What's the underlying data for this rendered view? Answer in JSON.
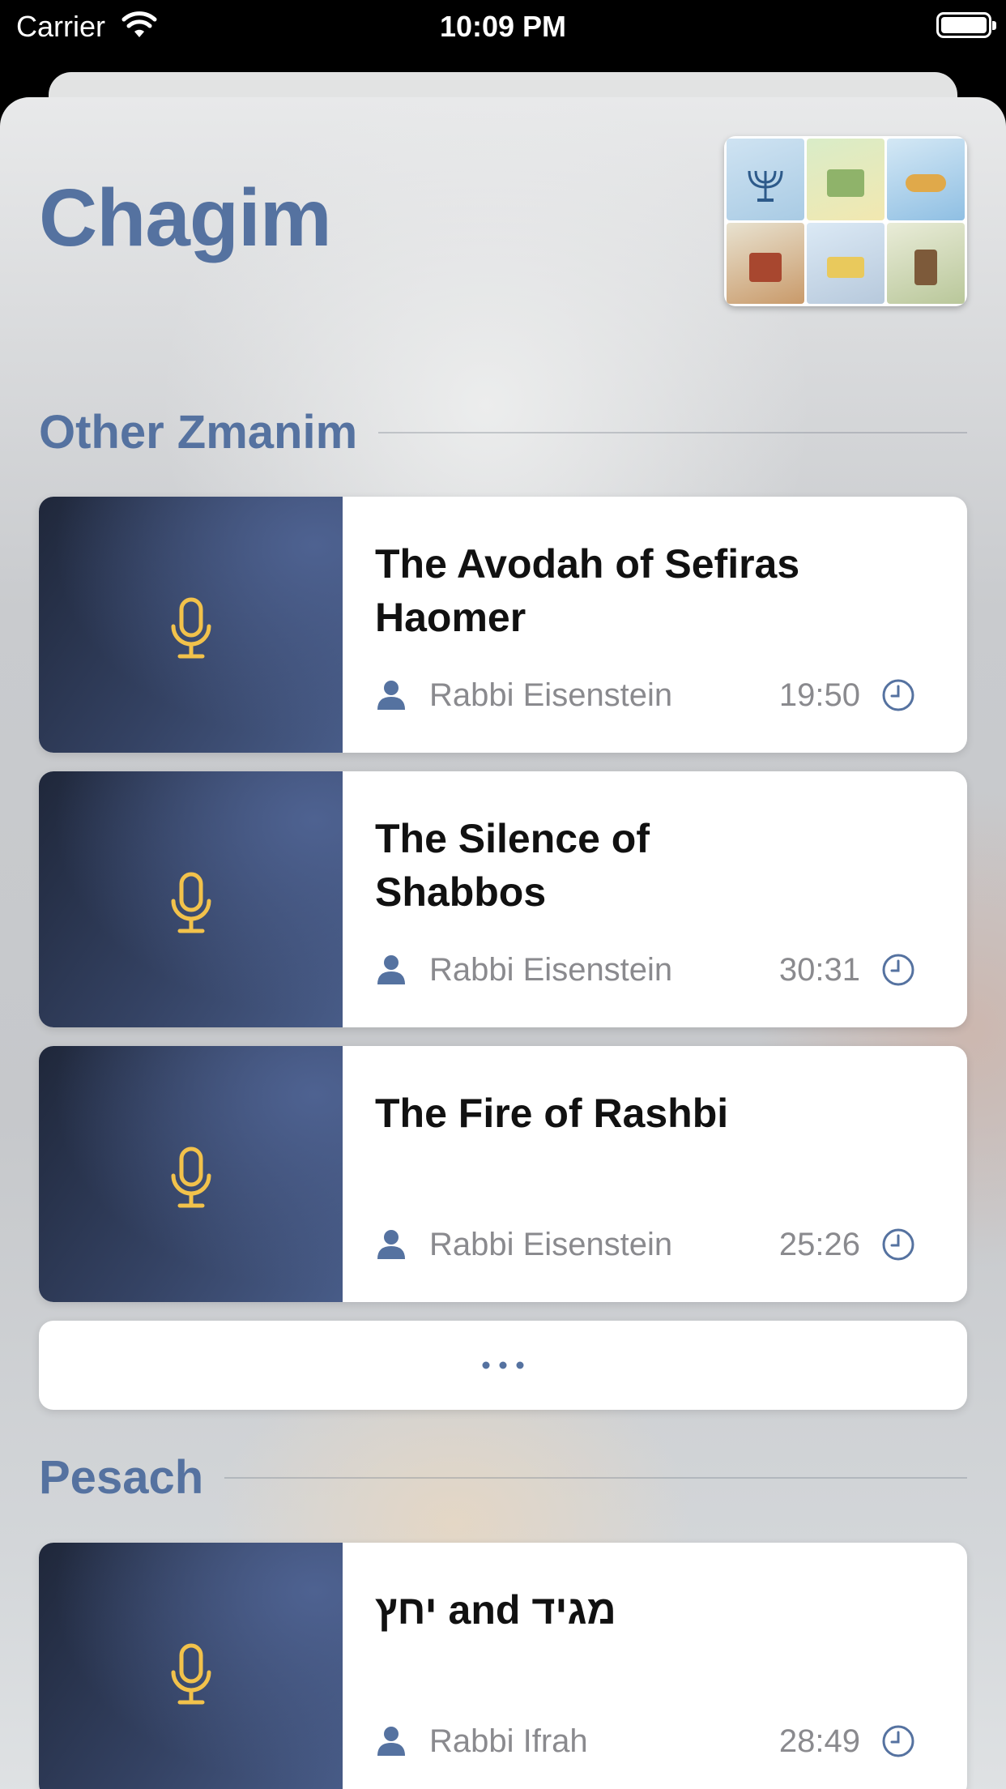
{
  "status_bar": {
    "carrier": "Carrier",
    "time": "10:09 PM",
    "battery_level": 1.0
  },
  "header": {
    "title": "Chagim",
    "thumbnail_icon": "holidays-collage-image"
  },
  "sections": [
    {
      "title": "Other Zmanim",
      "items": [
        {
          "title": "The Avodah of Sefiras Haomer",
          "author": "Rabbi Eisenstein",
          "duration": "19:50"
        },
        {
          "title": "The Silence of Shabbos",
          "author": "Rabbi Eisenstein",
          "duration": "30:31"
        },
        {
          "title": "The Fire of Rashbi",
          "author": "Rabbi Eisenstein",
          "duration": "25:26"
        }
      ],
      "more_icon": "ellipsis-icon"
    },
    {
      "title": "Pesach",
      "items": [
        {
          "title": "יחץ and מגיד",
          "author": "Rabbi Ifrah",
          "duration": "28:49"
        }
      ]
    }
  ],
  "icons": {
    "card_art": "microphone-icon",
    "author": "person-icon",
    "duration": "clock-icon"
  },
  "colors": {
    "accent": "#5572a0",
    "mic": "#f2c24b",
    "card_art_dark": "#1f273a",
    "card_art_light": "#485c88"
  }
}
